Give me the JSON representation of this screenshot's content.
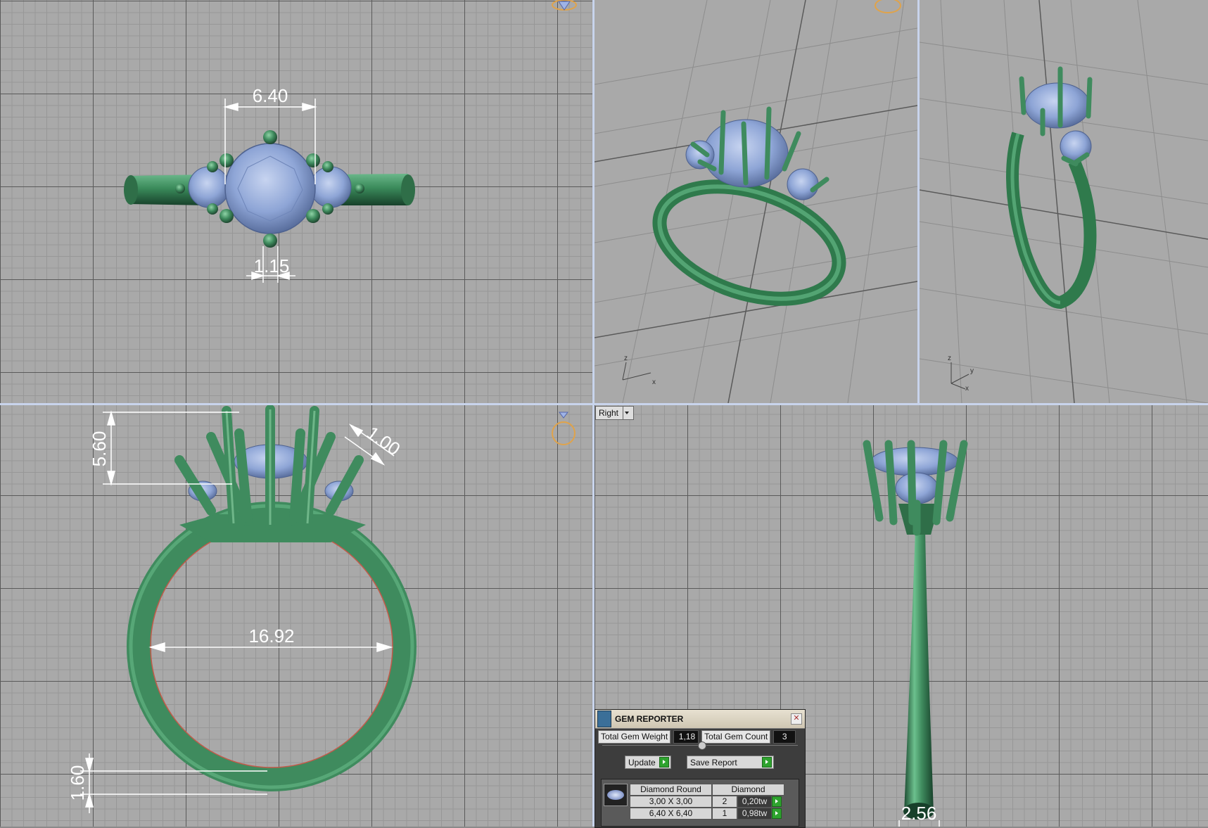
{
  "viewports": {
    "top": {
      "dimensions": [
        "6.40",
        "1.15"
      ]
    },
    "front": {
      "dimensions": [
        "5.60",
        "1.00",
        "16.92",
        "1.60"
      ]
    },
    "right": {
      "label": "Right",
      "dimensions": [
        "2.56"
      ]
    }
  },
  "gem_reporter": {
    "title": "GEM REPORTER",
    "total_weight_label": "Total Gem Weight",
    "total_weight_value": "1,18",
    "total_count_label": "Total Gem Count",
    "total_count_value": "3",
    "update_label": "Update",
    "save_label": "Save Report",
    "shape_header": "Diamond Round",
    "material_header": "Diamond",
    "rows": [
      {
        "size": "3,00 X 3,00",
        "count": "2",
        "weight": "0,20tw"
      },
      {
        "size": "6,40 X 6,40",
        "count": "1",
        "weight": "0,98tw"
      }
    ]
  },
  "colors": {
    "metal": "#3f8b5e",
    "gem": "#8ea5d6",
    "viewport": "#a9a9a9",
    "divider": "#c8d4ec"
  },
  "icons": [
    "gem-icon",
    "ring-icon",
    "close-icon",
    "play-icon"
  ]
}
